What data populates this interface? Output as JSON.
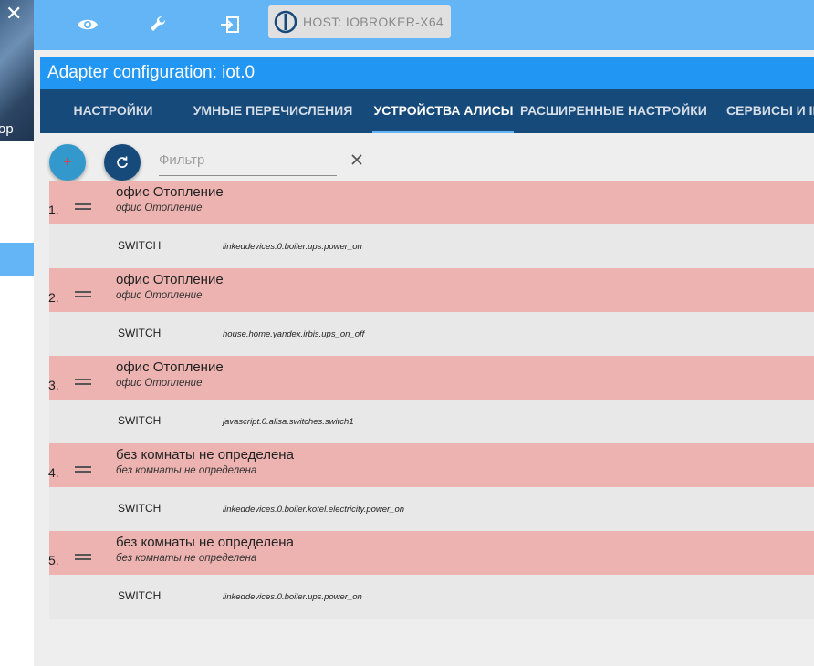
{
  "sidebar": {
    "close_glyph": "✕",
    "partial_label": "op"
  },
  "topbar": {
    "icons": [
      "eye-icon",
      "wrench-icon",
      "login-icon"
    ],
    "host_label": "HOST: IOBROKER-X64"
  },
  "dialog": {
    "title": "Adapter configuration: iot.0",
    "tabs": [
      {
        "label": "НАСТРОЙКИ",
        "active": false
      },
      {
        "label": "УМНЫЕ ПЕРЕЧИСЛЕНИЯ",
        "active": false
      },
      {
        "label": "УСТРОЙСТВА АЛИСЫ",
        "active": true
      },
      {
        "label": "РАСШИРЕННЫЕ НАСТРОЙКИ",
        "active": false
      },
      {
        "label": "СЕРВИСЫ И IF",
        "active": false
      }
    ]
  },
  "toolbar": {
    "add_label": "+",
    "filter_placeholder": "Фильтр",
    "filter_value": ""
  },
  "devices": [
    {
      "num": "1.",
      "name": "офис Отопление",
      "desc": "офис Отопление",
      "type": "SWITCH",
      "oid": "linkeddevices.0.boiler.ups.power_on"
    },
    {
      "num": "2.",
      "name": "офис Отопление",
      "desc": "офис Отопление",
      "type": "SWITCH",
      "oid": "house.home.yandex.irbis.ups_on_off"
    },
    {
      "num": "3.",
      "name": "офис Отопление",
      "desc": "офис Отопление",
      "type": "SWITCH",
      "oid": "javascript.0.alisa.switches.switch1"
    },
    {
      "num": "4.",
      "name": "без комнаты не определена",
      "desc": "без комнаты не определена",
      "type": "SWITCH",
      "oid": "linkeddevices.0.boiler.kotel.electricity.power_on"
    },
    {
      "num": "5.",
      "name": "без комнаты не определена",
      "desc": "без комнаты не определена",
      "type": "SWITCH",
      "oid": "linkeddevices.0.boiler.ups.power_on"
    }
  ],
  "colors": {
    "appbar": "#64b5f6",
    "title_bar": "#2196f3",
    "tabs_bar": "#164a7b",
    "row_highlight": "#ecb3b1",
    "row_sub": "#e8e8e8"
  }
}
